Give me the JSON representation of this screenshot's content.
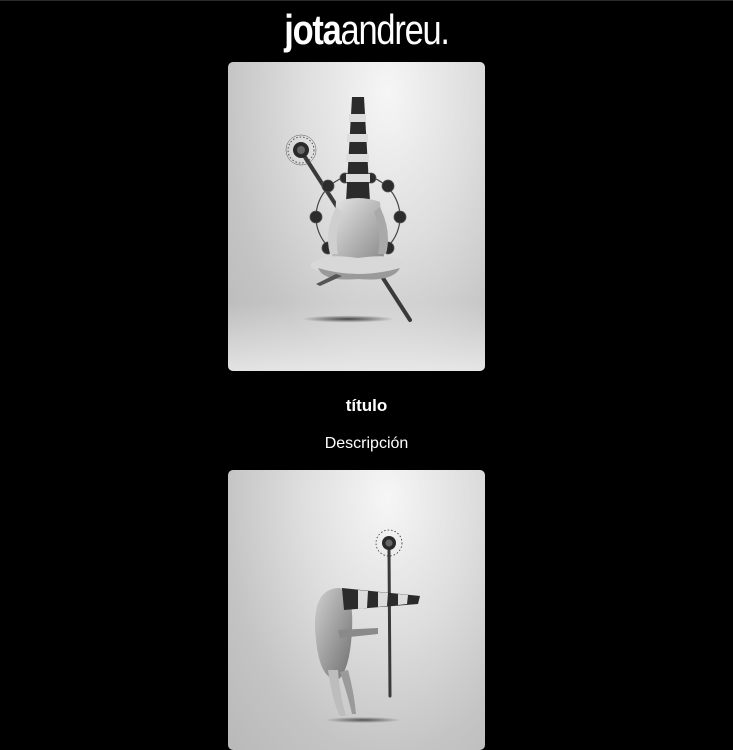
{
  "brand": {
    "bold": "jota",
    "light": "andreu."
  },
  "gallery": [
    {
      "title": "título",
      "description": "Descripción"
    }
  ]
}
